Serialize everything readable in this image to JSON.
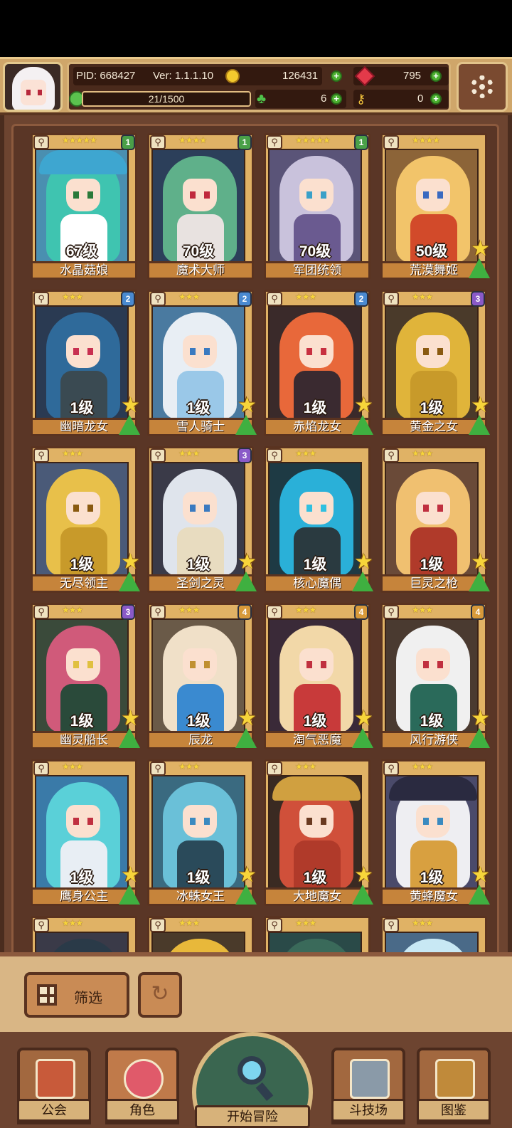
{
  "header": {
    "pid": "PID: 668427",
    "version": "Ver: 1.1.1.10",
    "gold": "126431",
    "gems": "795",
    "exp": "21/1500",
    "clovers": "6",
    "keys": "0"
  },
  "heroes": [
    {
      "name": "水晶菇娘",
      "level": "67级",
      "stars": "★★★★★",
      "badge": "1",
      "hair": "#3fc4b0",
      "bg": "#4a8fb0",
      "body": "#ffffff",
      "eye": "#2a7a3a",
      "hat": "#3ea6d0"
    },
    {
      "name": "魔术大师",
      "level": "70级",
      "stars": "★★★★",
      "badge": "1",
      "hair": "#5fb08a",
      "bg": "#2c3f5a",
      "body": "#e8e2e0",
      "eye": "#c0283c",
      "hat": ""
    },
    {
      "name": "军团统领",
      "level": "70级",
      "stars": "★★★★★",
      "badge": "1",
      "hair": "#c9c2dc",
      "bg": "#5a5478",
      "body": "#6a5a90",
      "eye": "#3aa0c8",
      "hat": ""
    },
    {
      "name": "荒漠舞姬",
      "level": "50级",
      "stars": "★★★★",
      "badge": "",
      "hair": "#f2c46a",
      "bg": "#8c6438",
      "body": "#d24a2a",
      "eye": "#3a6ac0",
      "hat": ""
    },
    {
      "name": "幽暗龙女",
      "level": "1级",
      "stars": "★★★",
      "badge": "2",
      "hair": "#2f6a9a",
      "bg": "#2a3a52",
      "body": "#3a4a52",
      "eye": "#c83050",
      "hat": ""
    },
    {
      "name": "雪人骑士",
      "level": "1级",
      "stars": "★★★",
      "badge": "2",
      "hair": "#e8eef4",
      "bg": "#4a7aa0",
      "body": "#9ac8e8",
      "eye": "#3a7ac0",
      "hat": ""
    },
    {
      "name": "赤焰龙女",
      "level": "1级",
      "stars": "★★★",
      "badge": "2",
      "hair": "#e8683a",
      "bg": "#3a2a2a",
      "body": "#3a2a30",
      "eye": "#c83040",
      "hat": ""
    },
    {
      "name": "黄金之女",
      "level": "1级",
      "stars": "★★★",
      "badge": "3",
      "hair": "#e0b43a",
      "bg": "#4a3a2a",
      "body": "#c89a2a",
      "eye": "#8a5a10",
      "hat": ""
    },
    {
      "name": "无尽领主",
      "level": "1级",
      "stars": "★★★",
      "badge": "",
      "hair": "#e8c04a",
      "bg": "#4a5a78",
      "body": "#c89a2a",
      "eye": "#8a5a10",
      "hat": ""
    },
    {
      "name": "圣剑之灵",
      "level": "1级",
      "stars": "★★★",
      "badge": "3",
      "hair": "#dfe4ec",
      "bg": "#3a3a48",
      "body": "#e8dcc0",
      "eye": "#3a7ac0",
      "hat": ""
    },
    {
      "name": "核心魔偶",
      "level": "1级",
      "stars": "★★★",
      "badge": "",
      "hair": "#2ab0d8",
      "bg": "#1e3a44",
      "body": "#2a3a40",
      "eye": "#30c0e0",
      "hat": ""
    },
    {
      "name": "巨灵之枪",
      "level": "1级",
      "stars": "★★★",
      "badge": "",
      "hair": "#f0c070",
      "bg": "#6a4a38",
      "body": "#b03a2a",
      "eye": "#c03040",
      "hat": ""
    },
    {
      "name": "幽灵船长",
      "level": "1级",
      "stars": "★★★",
      "badge": "3",
      "hair": "#d05a7a",
      "bg": "#3a4a3a",
      "body": "#2a4a3a",
      "eye": "#e0c040",
      "hat": ""
    },
    {
      "name": "辰龙",
      "level": "1级",
      "stars": "★★★",
      "badge": "4",
      "hair": "#f0e0c8",
      "bg": "#6a5a48",
      "body": "#3a8ad0",
      "eye": "#c09030",
      "hat": ""
    },
    {
      "name": "淘气恶魔",
      "level": "1级",
      "stars": "★★★",
      "badge": "4",
      "hair": "#f2d8a8",
      "bg": "#3a2a38",
      "body": "#c83a3a",
      "eye": "#c03040",
      "hat": ""
    },
    {
      "name": "风行游侠",
      "level": "1级",
      "stars": "★★★",
      "badge": "4",
      "hair": "#f0f0f0",
      "bg": "#4a3a30",
      "body": "#2a6a5a",
      "eye": "#c03040",
      "hat": ""
    },
    {
      "name": "鹰身公主",
      "level": "1级",
      "stars": "★★★",
      "badge": "",
      "hair": "#5ad0d8",
      "bg": "#3a7aa8",
      "body": "#e8eef4",
      "eye": "#c03040",
      "hat": ""
    },
    {
      "name": "冰蛛女王",
      "level": "1级",
      "stars": "★★★",
      "badge": "",
      "hair": "#6ac0d8",
      "bg": "#3a6a80",
      "body": "#2a4a5a",
      "eye": "#3a8ac0",
      "hat": ""
    },
    {
      "name": "大地魔女",
      "level": "1级",
      "stars": "★★★",
      "badge": "",
      "hair": "#d0503a",
      "bg": "#3a2a22",
      "body": "#b03a2a",
      "eye": "#6a3a20",
      "hat": "#d0a040"
    },
    {
      "name": "黄蜂魔女",
      "level": "1级",
      "stars": "★★★",
      "badge": "",
      "hair": "#eeeef2",
      "bg": "#4a4a6a",
      "body": "#d8a040",
      "eye": "#3a8ac0",
      "hat": "#2a2a40"
    },
    {
      "name": "",
      "level": "",
      "stars": "★★★",
      "badge": "",
      "hair": "#2a3a48",
      "bg": "#3a3a48",
      "body": "#2a3a48",
      "eye": "",
      "hat": ""
    },
    {
      "name": "",
      "level": "",
      "stars": "★★★",
      "badge": "",
      "hair": "#e8b83a",
      "bg": "#4a3a2a",
      "body": "#e8b83a",
      "eye": "",
      "hat": ""
    },
    {
      "name": "",
      "level": "",
      "stars": "★★★",
      "badge": "",
      "hair": "#3a6a5a",
      "bg": "#2a4a48",
      "body": "#3a6a5a",
      "eye": "",
      "hat": ""
    },
    {
      "name": "",
      "level": "",
      "stars": "★★★",
      "badge": "",
      "hair": "#c8e8f4",
      "bg": "#4a6a88",
      "body": "#c8e8f4",
      "eye": "",
      "hat": ""
    }
  ],
  "badge_colors": {
    "1": "#4aa048",
    "2": "#4a8ad0",
    "3": "#8a5ac8",
    "4": "#d89a3a"
  },
  "filter": {
    "label": "筛选"
  },
  "nav": {
    "guild": "公会",
    "role": "角色",
    "adventure": "开始冒险",
    "arena": "斗技场",
    "codex": "图鉴"
  }
}
